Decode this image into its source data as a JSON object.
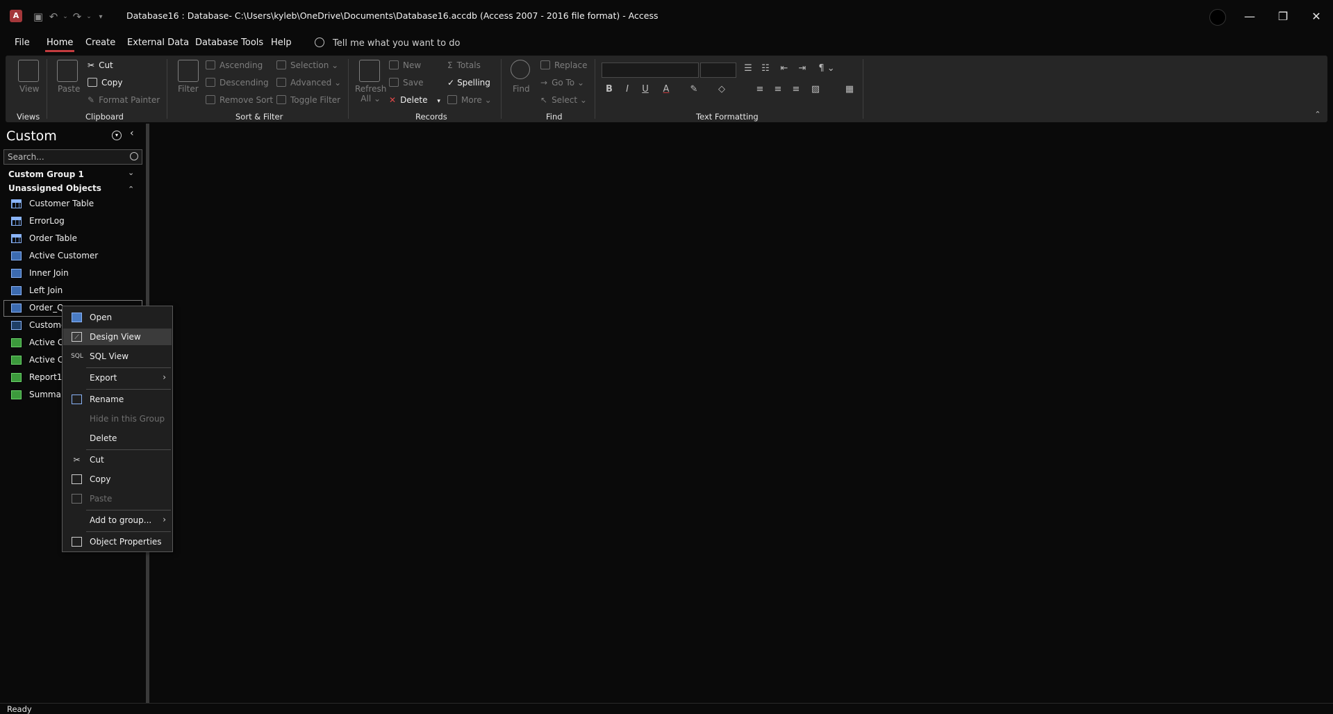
{
  "window": {
    "title": "Database16 : Database- C:\\Users\\kyleb\\OneDrive\\Documents\\Database16.accdb (Access 2007 - 2016 file format)  -  Access",
    "app_icon_letter": "A",
    "minimize": "—",
    "restore": "❐",
    "close": "✕"
  },
  "menu": {
    "tabs": [
      "File",
      "Home",
      "Create",
      "External Data",
      "Database Tools",
      "Help"
    ],
    "active_tab": "Home",
    "tell_me_placeholder": "Tell me what you want to do"
  },
  "ribbon": {
    "views": {
      "label": "Views",
      "view": "View"
    },
    "clipboard": {
      "label": "Clipboard",
      "paste": "Paste",
      "cut": "Cut",
      "copy": "Copy",
      "format_painter": "Format Painter"
    },
    "sort_filter": {
      "label": "Sort & Filter",
      "filter": "Filter",
      "ascending": "Ascending",
      "descending": "Descending",
      "remove_sort": "Remove Sort",
      "selection": "Selection",
      "advanced": "Advanced",
      "toggle_filter": "Toggle Filter"
    },
    "records": {
      "label": "Records",
      "refresh": "Refresh",
      "refresh_all": "All",
      "new": "New",
      "save": "Save",
      "delete": "Delete",
      "totals": "Totals",
      "spelling": "Spelling",
      "more": "More"
    },
    "find": {
      "label": "Find",
      "find": "Find",
      "replace": "Replace",
      "go_to": "Go To",
      "select": "Select"
    },
    "text_formatting": {
      "label": "Text Formatting",
      "bold": "B",
      "italic": "I",
      "underline": "U",
      "font_color": "A"
    }
  },
  "nav": {
    "title": "Custom",
    "search_placeholder": "Search...",
    "groups": [
      {
        "label": "Custom Group 1",
        "chevron": "⌄"
      },
      {
        "label": "Unassigned Objects",
        "chevron": "⌃"
      }
    ],
    "items": [
      {
        "label": "Customer Table",
        "icon": "table-icon"
      },
      {
        "label": "ErrorLog",
        "icon": "table-icon"
      },
      {
        "label": "Order Table",
        "icon": "table-icon"
      },
      {
        "label": "Active Customer",
        "icon": "query-icon"
      },
      {
        "label": "Inner Join",
        "icon": "query-icon"
      },
      {
        "label": "Left Join",
        "icon": "query-icon"
      },
      {
        "label": "Order_Qu",
        "icon": "query-icon"
      },
      {
        "label": "Custome",
        "icon": "form-icon"
      },
      {
        "label": "Active Cu",
        "icon": "report-icon"
      },
      {
        "label": "Active Cu",
        "icon": "report-icon"
      },
      {
        "label": "Report1",
        "icon": "report-icon"
      },
      {
        "label": "Summar",
        "icon": "report-icon"
      }
    ]
  },
  "context_menu": {
    "items": [
      {
        "label": "Open",
        "icon": "open-icon",
        "disabled": false
      },
      {
        "label": "Design View",
        "icon": "design-view-icon",
        "disabled": false,
        "hover": true
      },
      {
        "label": "SQL View",
        "icon": "sql-icon",
        "icon_text": "SQL",
        "disabled": false
      },
      {
        "label": "Export",
        "submenu": true,
        "disabled": false
      },
      {
        "label": "Rename",
        "icon": "rename-icon",
        "disabled": false
      },
      {
        "label": "Hide in this Group",
        "disabled": true
      },
      {
        "label": "Delete",
        "disabled": false
      },
      {
        "label": "Cut",
        "icon": "scissors-icon",
        "disabled": false
      },
      {
        "label": "Copy",
        "icon": "copy-icon",
        "disabled": false
      },
      {
        "label": "Paste",
        "icon": "paste-icon",
        "disabled": true
      },
      {
        "label": "Add to group...",
        "submenu": true,
        "disabled": false
      },
      {
        "label": "Object Properties",
        "icon": "properties-icon",
        "disabled": false
      }
    ]
  },
  "status": {
    "text": "Ready"
  },
  "colors": {
    "accent": "#c33b3e",
    "background": "#0a0a0a",
    "ribbon": "#262626"
  }
}
